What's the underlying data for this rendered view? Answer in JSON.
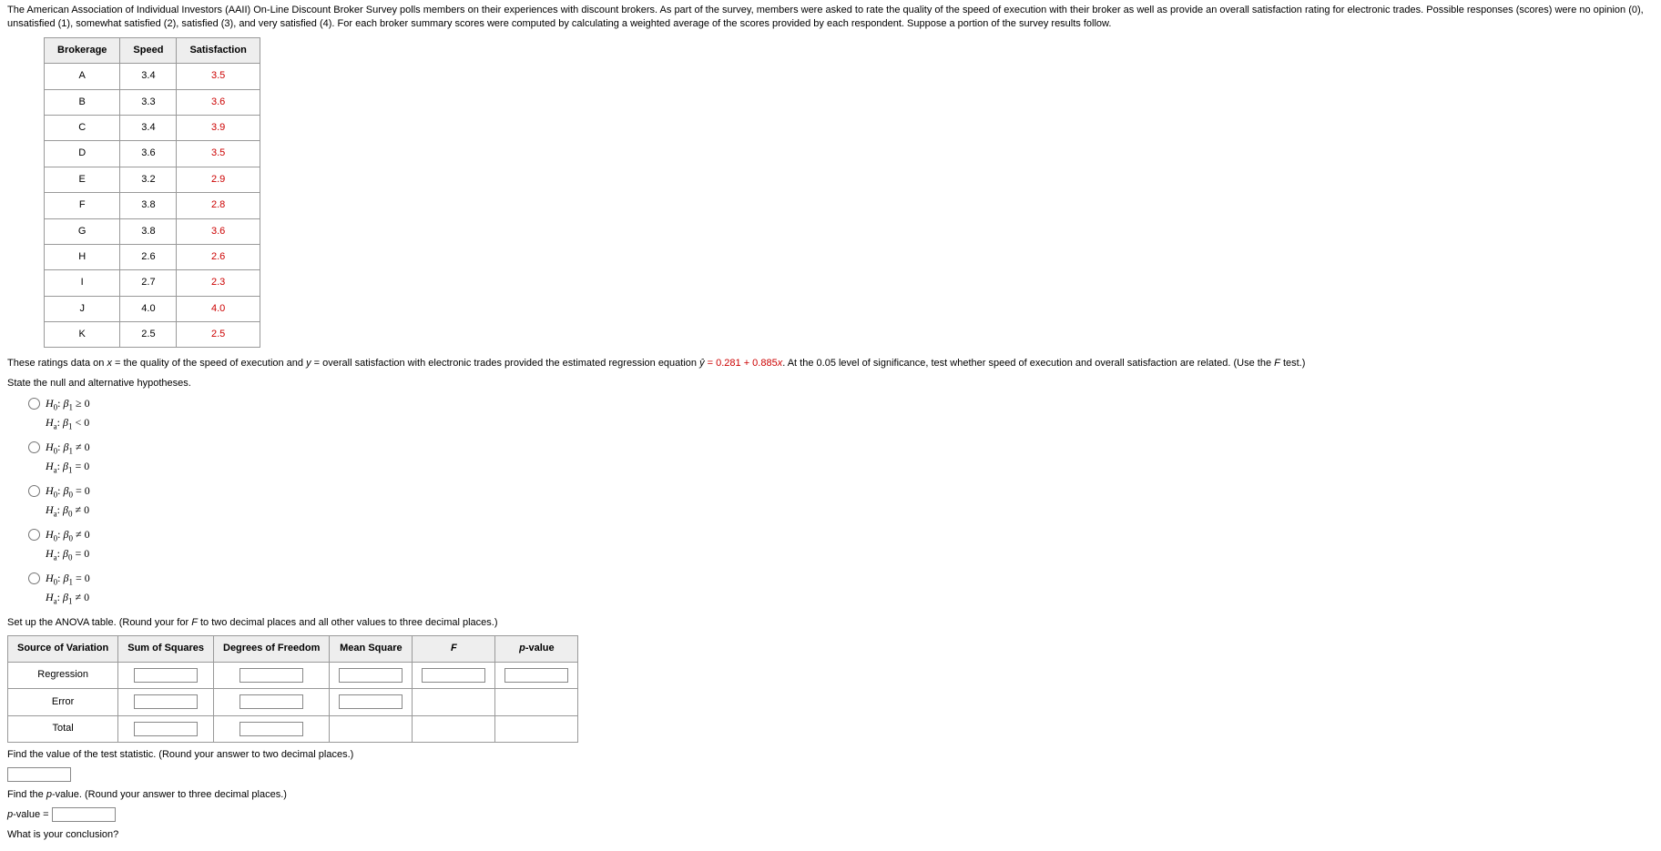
{
  "intro_p1": "The American Association of Individual Investors (AAII) On-Line Discount Broker Survey polls members on their experiences with discount brokers. As part of the survey, members were asked to rate the quality of the speed of execution with their broker as well as provide an overall satisfaction rating for electronic trades. Possible responses (scores) were no opinion (0), unsatisfied (1), somewhat satisfied (2), satisfied (3), and very satisfied (4). For each broker summary scores were computed by calculating a weighted average of the scores provided by each respondent. Suppose a portion of the survey results follow.",
  "headers": {
    "c1": "Brokerage",
    "c2": "Speed",
    "c3": "Satisfaction"
  },
  "rows": [
    {
      "b": "A",
      "s": "3.4",
      "sat": "3.5"
    },
    {
      "b": "B",
      "s": "3.3",
      "sat": "3.6"
    },
    {
      "b": "C",
      "s": "3.4",
      "sat": "3.9"
    },
    {
      "b": "D",
      "s": "3.6",
      "sat": "3.5"
    },
    {
      "b": "E",
      "s": "3.2",
      "sat": "2.9"
    },
    {
      "b": "F",
      "s": "3.8",
      "sat": "2.8"
    },
    {
      "b": "G",
      "s": "3.8",
      "sat": "3.6"
    },
    {
      "b": "H",
      "s": "2.6",
      "sat": "2.6"
    },
    {
      "b": "I",
      "s": "2.7",
      "sat": "2.3"
    },
    {
      "b": "J",
      "s": "4.0",
      "sat": "4.0"
    },
    {
      "b": "K",
      "s": "2.5",
      "sat": "2.5"
    }
  ],
  "reg_line_pre": "These ratings data on ",
  "reg_x": "x",
  "reg_eq_txt1": " = the quality of the speed of execution and ",
  "reg_y": "y",
  "reg_eq_txt2": " = overall satisfaction with electronic trades provided the estimated regression equation ",
  "yhat": "ŷ",
  "eq_val": " = 0.281 + 0.885",
  "reg_post": ". At the 0.05 level of significance, test whether speed of execution and overall satisfaction are related. (Use the ",
  "f_test": "F",
  "reg_post2": " test.)",
  "state_hyp": "State the null and alternative hypotheses.",
  "hyps": [
    {
      "l1": "H₀: β₁ ≥ 0",
      "l2": "Hₐ: β₁ < 0"
    },
    {
      "l1": "H₀: β₁ ≠ 0",
      "l2": "Hₐ: β₁ = 0"
    },
    {
      "l1": "H₀: β₀ = 0",
      "l2": "Hₐ: β₀ ≠ 0"
    },
    {
      "l1": "H₀: β₀ ≠ 0",
      "l2": "Hₐ: β₀ = 0"
    },
    {
      "l1": "H₀: β₁ = 0",
      "l2": "Hₐ: β₁ ≠ 0"
    }
  ],
  "anova_prompt_pre": "Set up the ANOVA table. (Round your for ",
  "anova_prompt_post": " to two decimal places and all other values to three decimal places.)",
  "anova_headers": {
    "c1": "Source\nof Variation",
    "c2": "Sum\nof Squares",
    "c3": "Degrees\nof Freedom",
    "c4": "Mean\nSquare",
    "c5": "F",
    "c6": "p-value"
  },
  "anova_rows": {
    "r1": "Regression",
    "r2": "Error",
    "r3": "Total"
  },
  "find_ts": "Find the value of the test statistic. (Round your answer to two decimal places.)",
  "find_p": "Find the ",
  "pval_word": "p",
  "find_p2": "-value. (Round your answer to three decimal places.)",
  "p_label": "-value = ",
  "conclusion": "What is your conclusion?"
}
